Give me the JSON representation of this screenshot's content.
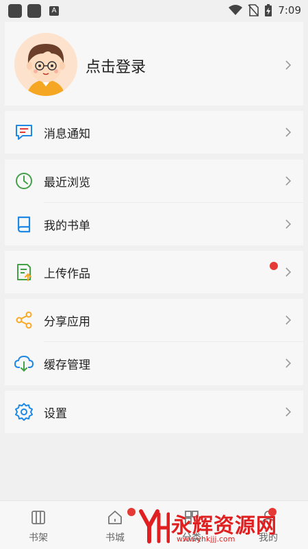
{
  "statusbar": {
    "time": "7:09"
  },
  "profile": {
    "login_label": "点击登录"
  },
  "menu": {
    "notifications": "消息通知",
    "recent": "最近浏览",
    "booklist": "我的书单",
    "upload": "上传作品",
    "share": "分享应用",
    "cache": "缓存管理",
    "settings": "设置"
  },
  "tabs": [
    {
      "label": "书架"
    },
    {
      "label": "书城"
    },
    {
      "label": "分类"
    },
    {
      "label": "我的"
    }
  ],
  "watermark": {
    "text": "永辉资源网",
    "url": "www.yhkjjj.com"
  },
  "colors": {
    "accent_red": "#e53935",
    "icon_blue": "#1e88e5",
    "icon_green": "#43a047",
    "icon_yellow": "#f9a825"
  }
}
